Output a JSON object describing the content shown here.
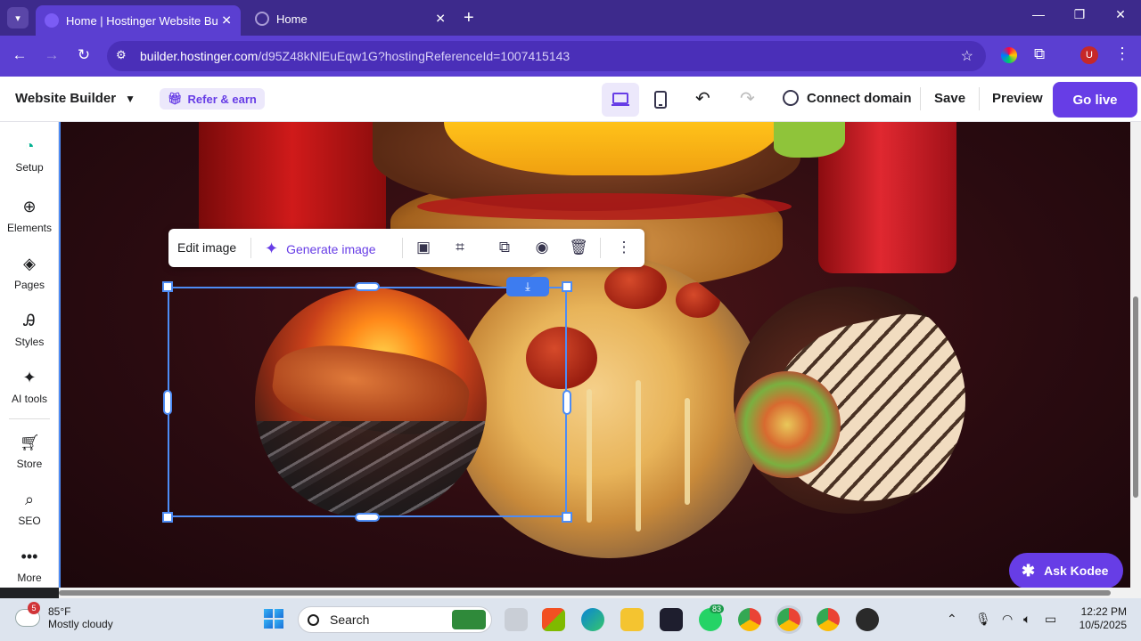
{
  "browser": {
    "tabs": [
      {
        "title": "Home | Hostinger Website Builder",
        "active": true
      },
      {
        "title": "Home",
        "active": false
      }
    ],
    "new_tab": "+",
    "url_host": "builder.hostinger.com",
    "url_path": "/d95Z48kNlEuEqw1G?hostingReferenceId=1007415143",
    "profile_initial": "U"
  },
  "builder": {
    "brand": "Website Builder",
    "refer": "Refer & earn",
    "connect_domain": "Connect domain",
    "save": "Save",
    "preview": "Preview",
    "go_live": "Go live"
  },
  "sidebar": {
    "items": [
      {
        "label": "Setup",
        "icon": "setup-icon"
      },
      {
        "label": "Elements",
        "icon": "plus-circle-icon"
      },
      {
        "label": "Pages",
        "icon": "layers-icon"
      },
      {
        "label": "Styles",
        "icon": "styles-icon"
      },
      {
        "label": "AI tools",
        "icon": "sparkle-icon"
      },
      {
        "label": "Store",
        "icon": "cart-icon"
      },
      {
        "label": "SEO",
        "icon": "seo-icon"
      },
      {
        "label": "More",
        "icon": "dots-icon"
      }
    ]
  },
  "image_toolbar": {
    "edit": "Edit image",
    "generate": "Generate image"
  },
  "kodee": "Ask Kodee",
  "taskbar": {
    "weather_temp": "85°F",
    "weather_desc": "Mostly cloudy",
    "weather_badge": "5",
    "search": "Search",
    "whatsapp_badge": "83",
    "time": "12:22 PM",
    "date": "10/5/2025"
  },
  "colors": {
    "brand_purple": "#673de6",
    "chrome_purple": "#5b3fd1",
    "selection_blue": "#4d8cf5"
  }
}
